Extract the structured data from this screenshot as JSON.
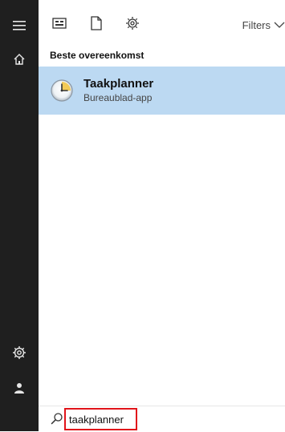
{
  "toolbar": {
    "icons": [
      "apps-icon",
      "documents-icon",
      "settings-web-icon"
    ],
    "filters_label": "Filters"
  },
  "results": {
    "section_title": "Beste overeenkomst",
    "items": [
      {
        "title": "Taakplanner",
        "subtitle": "Bureaublad-app",
        "icon": "clock-icon"
      }
    ]
  },
  "search": {
    "value": "taakplanner"
  },
  "colors": {
    "rail_bg": "#1f1f1f",
    "highlight_bg": "#bcd9f2",
    "search_border": "#e1141a"
  }
}
